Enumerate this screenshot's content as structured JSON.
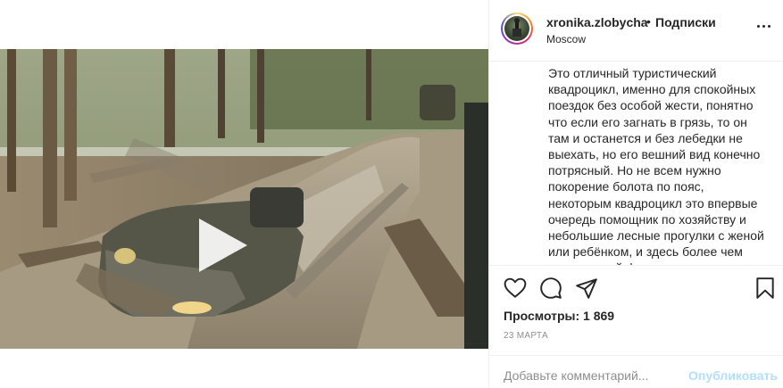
{
  "post": {
    "username": "xronika.zlobycha",
    "separator": "•",
    "follow_label": "Подписки",
    "location": "Moscow",
    "caption": "Это отличный туристический квадроцикл, именно для спокойных поездок без особой жести, понятно что если его загнать в грязь, то он там и останется и без лебедки не выехать, но его вешний вид конечно потрясный. Но не всем нужно покорение болота по пояс, некоторым квадроцикл это впервые очередь помощник по хозяйству и небольшие лесные прогулки с женой или ребёнком, и здесь более чем достаточный функционал.",
    "views": "Просмотры: 1 869",
    "date": "23 МАРТА",
    "comment_placeholder": "Добавьте комментарий...",
    "publish_label": "Опубликовать"
  },
  "icons": {
    "more": "more-options-icon",
    "like": "heart-icon",
    "comment": "comment-icon",
    "share": "paper-plane-icon",
    "save": "bookmark-icon",
    "play": "play-icon"
  },
  "colors": {
    "text": "#262626",
    "muted": "#8e8e8e",
    "border": "#efefef",
    "publish_disabled": "#b2dffc"
  }
}
